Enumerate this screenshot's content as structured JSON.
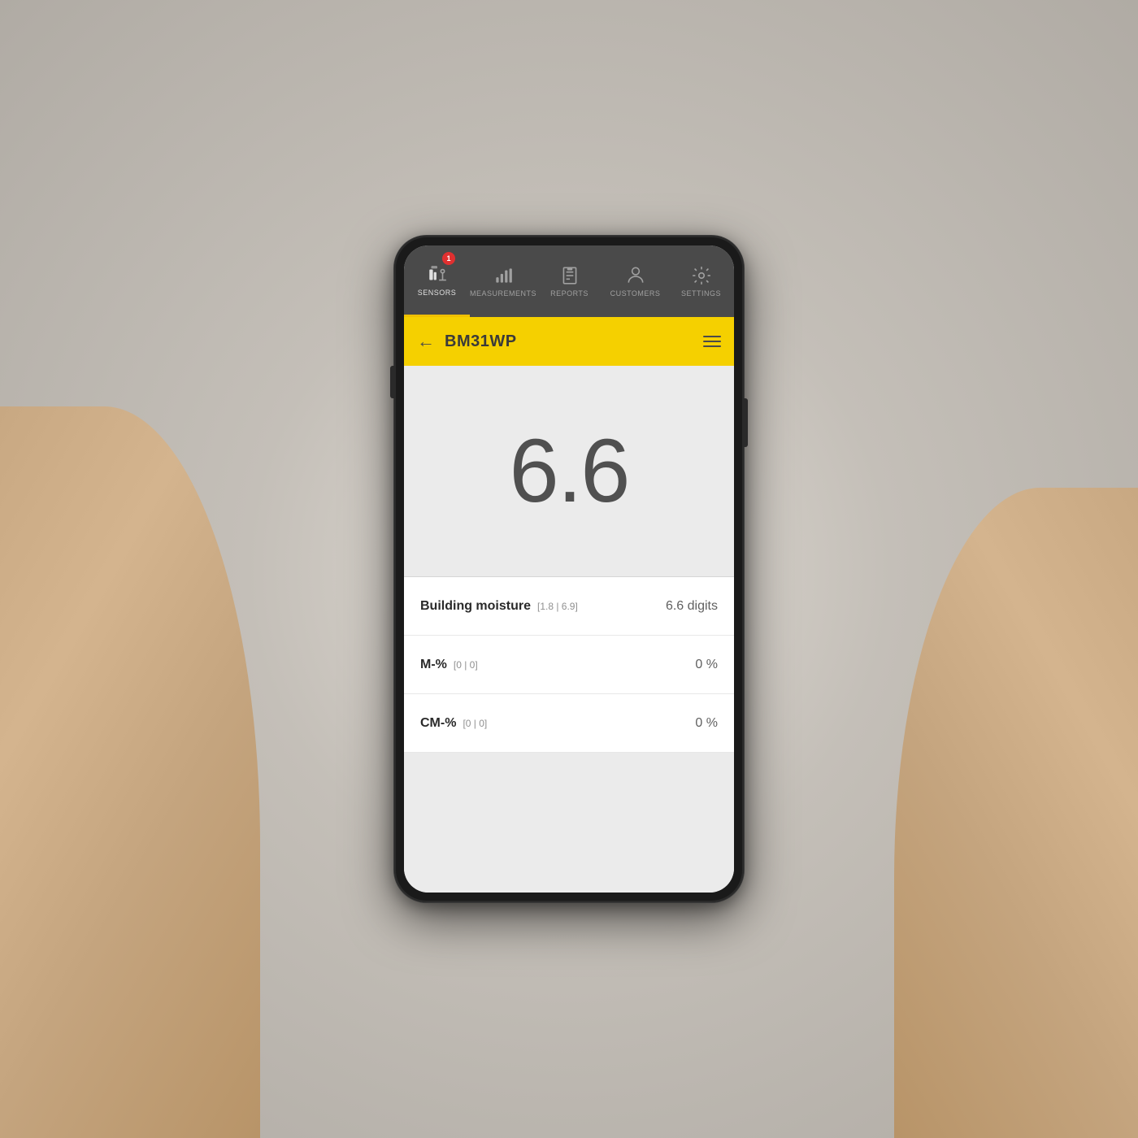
{
  "background": {
    "color": "#c0bbb4"
  },
  "nav": {
    "items": [
      {
        "id": "sensors",
        "label": "SENSORS",
        "active": true,
        "badge": "1"
      },
      {
        "id": "measurements",
        "label": "MEASUREMENTS",
        "active": false
      },
      {
        "id": "reports",
        "label": "REPORTS",
        "active": false
      },
      {
        "id": "customers",
        "label": "CUSTOMERS",
        "active": false
      },
      {
        "id": "settings",
        "label": "SETTINGS",
        "active": false
      }
    ]
  },
  "header": {
    "title": "BM31WP",
    "back_label": "←",
    "menu_label": "≡"
  },
  "reading": {
    "value": "6.6"
  },
  "rows": [
    {
      "label": "Building moisture",
      "range": "[1.8 | 6.9]",
      "value": "6.6 digits"
    },
    {
      "label": "M-%",
      "range": "[0 | 0]",
      "value": "0 %"
    },
    {
      "label": "CM-%",
      "range": "[0 | 0]",
      "value": "0 %"
    }
  ]
}
